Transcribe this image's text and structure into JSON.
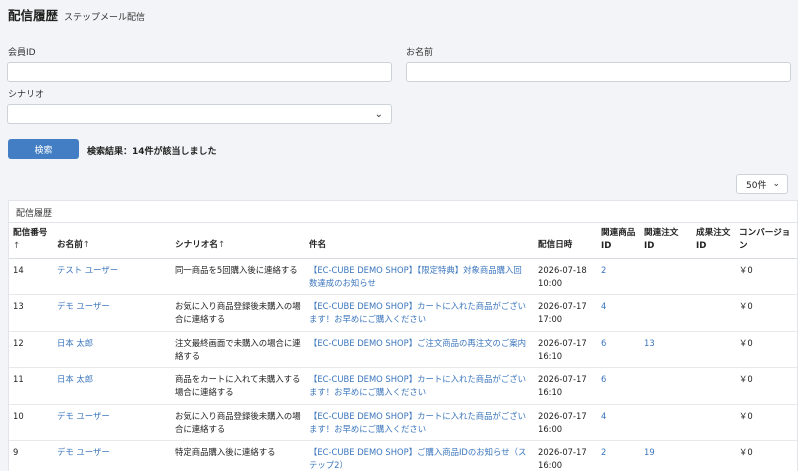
{
  "header": {
    "title": "配信履歴",
    "subtitle": "ステップメール配信"
  },
  "form": {
    "member_id_label": "会員ID",
    "member_id_value": "",
    "name_label": "お名前",
    "name_value": "",
    "scenario_label": "シナリオ",
    "scenario_value": "",
    "search_button": "検索",
    "result_text": "検索結果：14件が該当しました"
  },
  "per_page": {
    "selected": "50件"
  },
  "card": {
    "title": "配信履歴"
  },
  "table": {
    "columns": [
      {
        "label": "配信番号",
        "sort": "↑"
      },
      {
        "label": "お名前",
        "sort": "↑"
      },
      {
        "label": "シナリオ名",
        "sort": "↑"
      },
      {
        "label": "件名",
        "sort": ""
      },
      {
        "label": "配信日時",
        "sort": ""
      },
      {
        "label": "関連商品ID",
        "sort": ""
      },
      {
        "label": "関連注文ID",
        "sort": ""
      },
      {
        "label": "成果注文ID",
        "sort": ""
      },
      {
        "label": "コンバージョン",
        "sort": ""
      }
    ],
    "rows": [
      {
        "no": "14",
        "name": "テスト ユーザー",
        "scenario": "同一商品を5回購入後に連絡する",
        "subject": "【EC-CUBE DEMO SHOP】【限定特典】対象商品購入回数達成のお知らせ",
        "date": "2026-07-18",
        "time": "10:00",
        "product_id": "2",
        "order_id": "",
        "result_order_id": "",
        "conversion": "￥0"
      },
      {
        "no": "13",
        "name": "デモ ユーザー",
        "scenario": "お気に入り商品登録後未購入の場合に連絡する",
        "subject": "【EC-CUBE DEMO SHOP】カートに入れた商品がございます！お早めにご購入ください",
        "date": "2026-07-17",
        "time": "17:00",
        "product_id": "4",
        "order_id": "",
        "result_order_id": "",
        "conversion": "￥0"
      },
      {
        "no": "12",
        "name": "日本 太郎",
        "scenario": "注文最終画面で未購入の場合に連絡する",
        "subject": "【EC-CUBE DEMO SHOP】ご注文商品の再注文のご案内",
        "date": "2026-07-17",
        "time": "16:10",
        "product_id": "6",
        "order_id": "13",
        "result_order_id": "",
        "conversion": "￥0"
      },
      {
        "no": "11",
        "name": "日本 太郎",
        "scenario": "商品をカートに入れて未購入する場合に連絡する",
        "subject": "【EC-CUBE DEMO SHOP】カートに入れた商品がございます！お早めにご購入ください",
        "date": "2026-07-17",
        "time": "16:10",
        "product_id": "6",
        "order_id": "",
        "result_order_id": "",
        "conversion": "￥0"
      },
      {
        "no": "10",
        "name": "デモ ユーザー",
        "scenario": "お気に入り商品登録後未購入の場合に連絡する",
        "subject": "【EC-CUBE DEMO SHOP】カートに入れた商品がございます！お早めにご購入ください",
        "date": "2026-07-17",
        "time": "16:00",
        "product_id": "4",
        "order_id": "",
        "result_order_id": "",
        "conversion": "￥0"
      },
      {
        "no": "9",
        "name": "デモ ユーザー",
        "scenario": "特定商品購入後に連絡する",
        "subject": "【EC-CUBE DEMO SHOP】ご購入商品IDのお知らせ（ステップ2）",
        "date": "2026-07-17",
        "time": "16:00",
        "product_id": "2",
        "order_id": "19",
        "result_order_id": "",
        "conversion": "￥0"
      }
    ]
  }
}
